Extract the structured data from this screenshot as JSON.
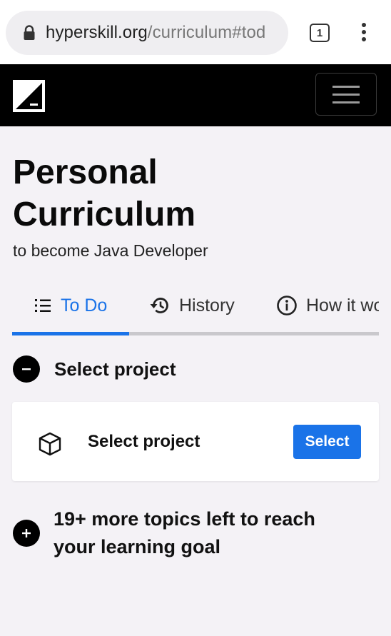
{
  "browser": {
    "url_host": "hyperskill.org",
    "url_path": "/curriculum#tod",
    "tab_count": "1"
  },
  "page": {
    "title_line1": "Personal",
    "title_line2": "Curriculum",
    "subtitle": "to become Java Developer"
  },
  "tabs": [
    {
      "label": "To Do",
      "icon": "list-icon",
      "active": true
    },
    {
      "label": "History",
      "icon": "history-icon",
      "active": false
    },
    {
      "label": "How it wo",
      "icon": "info-icon",
      "active": false
    }
  ],
  "section": {
    "label": "Select project",
    "icon": "minus-circle-icon"
  },
  "card": {
    "label": "Select project",
    "icon": "cube-icon",
    "button_label": "Select"
  },
  "more": {
    "text": "19+ more topics left to reach your learning goal",
    "icon": "plus-circle-icon"
  },
  "colors": {
    "accent": "#1a73e8",
    "header_bg": "#000000",
    "page_bg": "#f4f2f6"
  }
}
